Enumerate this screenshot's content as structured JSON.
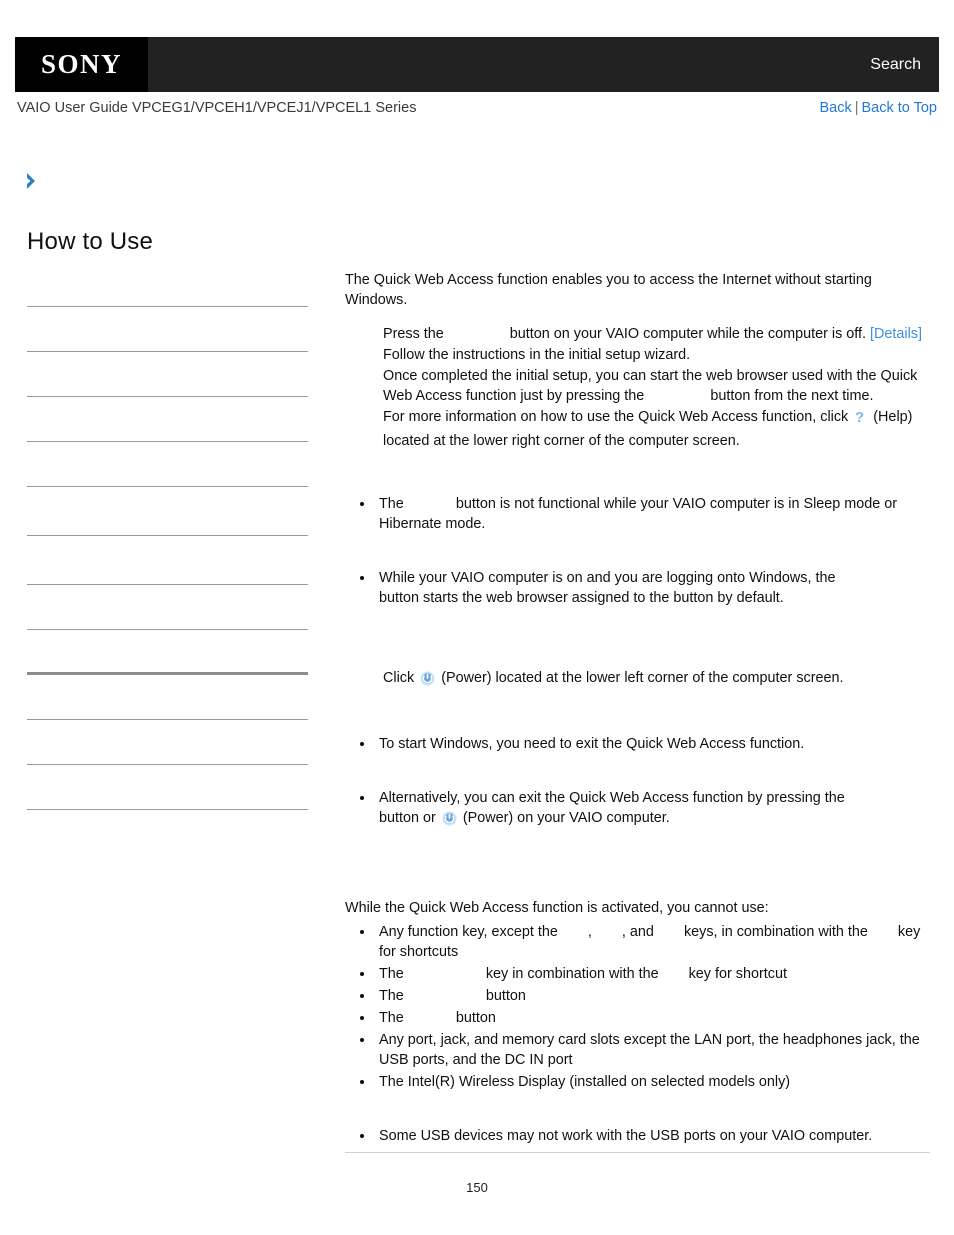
{
  "header": {
    "logo_text": "SONY",
    "search_label": "Search",
    "logo_bg": "#000000",
    "bar_bg": "#222222"
  },
  "subheader": {
    "guide_title": "VAIO User Guide VPCEG1/VPCEH1/VPCEJ1/VPCEL1 Series",
    "back_label": "Back",
    "separator": "|",
    "back_to_top_label": "Back to Top",
    "link_color": "#2277dd"
  },
  "sidebar": {
    "chevron_icon": "chevron-right-icon",
    "chevron_color": "#2c82c9",
    "title": "How to Use",
    "items": [
      {
        "label": ""
      },
      {
        "label": ""
      },
      {
        "label": ""
      },
      {
        "label": ""
      },
      {
        "label": ""
      },
      {
        "label": ""
      },
      {
        "label": ""
      },
      {
        "label": ""
      },
      {
        "label": ""
      },
      {
        "label": ""
      },
      {
        "label": ""
      },
      {
        "label": ""
      }
    ]
  },
  "main": {
    "intro": "The Quick Web Access function enables you to access the Internet without starting Windows.",
    "steps": [
      {
        "before": "Press the",
        "after": "button on your VAIO computer while the computer is off.",
        "link": "[Details]"
      },
      {
        "text": "Follow the instructions in the initial setup wizard."
      },
      {
        "before": "Once completed the initial setup, you can start the web browser used with the Quick Web Access function just by pressing the",
        "after": "button from the next time."
      },
      {
        "before": "For more information on how to use the Quick Web Access function, click",
        "icon": "help-icon",
        "after": "(Help) located at the lower right corner of the computer screen."
      }
    ],
    "notes": [
      {
        "before": "The",
        "after": "button is not functional while your VAIO computer is in Sleep mode or Hibernate mode."
      },
      {
        "before": "While your VAIO computer is on and you are logging onto Windows, the",
        "after": "button starts the web browser assigned to the button by default."
      }
    ],
    "exit_instruction": {
      "before": "Click",
      "icon": "power-icon",
      "after": "(Power) located at the lower left corner of the computer screen."
    },
    "exit_notes": [
      {
        "text": "To start Windows, you need to exit the Quick Web Access function."
      },
      {
        "before": "Alternatively, you can exit the Quick Web Access function by pressing the",
        "mid": "button or",
        "icon": "power-icon",
        "after": "(Power) on your VAIO computer."
      }
    ],
    "restrictions_intro": "While the Quick Web Access function is activated, you cannot use:",
    "restrictions": [
      {
        "p1": "Any function key, except the",
        "p2": ",",
        "p3": ", and",
        "p4": "keys, in combination with the",
        "p5": "key for shortcuts"
      },
      {
        "p1": "The",
        "p2": "key in combination with the",
        "p3": "key for shortcut"
      },
      {
        "p1": "The",
        "p2": "button"
      },
      {
        "p1": "The",
        "p2": "button"
      },
      {
        "p1": "Any port, jack, and memory card slots except the LAN port, the headphones jack, the USB ports, and the DC IN port"
      },
      {
        "p1": "The Intel(R) Wireless Display (installed on selected models only)"
      }
    ],
    "final_note": "Some USB devices may not work with the USB ports on your VAIO computer."
  },
  "footer": {
    "page_number": "150"
  }
}
